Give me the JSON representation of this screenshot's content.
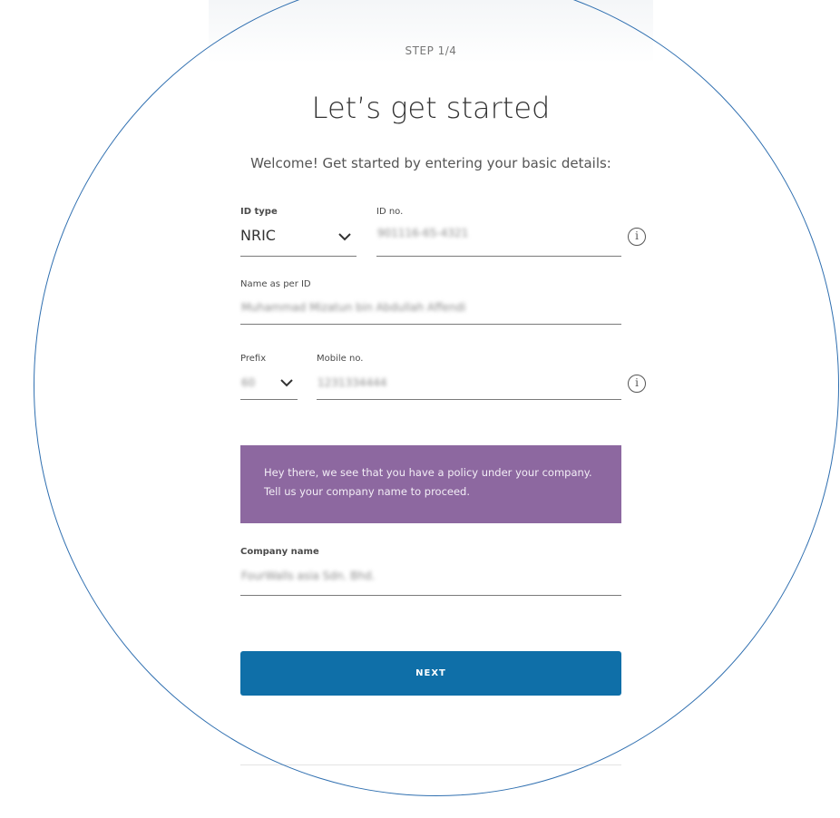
{
  "header": {
    "step": "STEP 1/4",
    "title": "Let’s get started",
    "subtitle": "Welcome! Get started by entering your basic details:"
  },
  "form": {
    "id_type": {
      "label": "ID type",
      "value": "NRIC"
    },
    "id_no": {
      "label": "ID no.",
      "value": "901116-65-4321"
    },
    "name": {
      "label": "Name as per ID",
      "value": "Muhammad Mizatun bin Abdullah Affendi"
    },
    "prefix": {
      "label": "Prefix",
      "value": "60"
    },
    "mobile": {
      "label": "Mobile no.",
      "value": "1231334444"
    },
    "company": {
      "label": "Company name",
      "value": "FourWalls asia Sdn. Bhd."
    }
  },
  "notice": {
    "text": "Hey there, we see that you have a policy under your company. Tell us your company name to proceed."
  },
  "actions": {
    "next_label": "NEXT"
  },
  "icons": {
    "info": "info-icon",
    "dropdown": "chevron-down-icon"
  },
  "colors": {
    "notice_bg": "#8d68a0",
    "button_bg": "#0f6fa8",
    "frame": "#2f6fb0"
  }
}
